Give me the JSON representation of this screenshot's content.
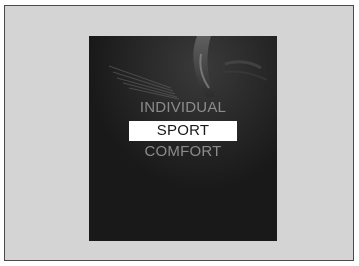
{
  "drive_mode_menu": {
    "options": [
      {
        "label": "INDIVIDUAL",
        "selected": false
      },
      {
        "label": "SPORT",
        "selected": true
      },
      {
        "label": "COMFORT",
        "selected": false
      }
    ]
  },
  "colors": {
    "outer_background": "#d4d4d4",
    "screen_background": "#191919",
    "selected_highlight": "#ffffff",
    "unselected_text": "#8c8c8c"
  }
}
